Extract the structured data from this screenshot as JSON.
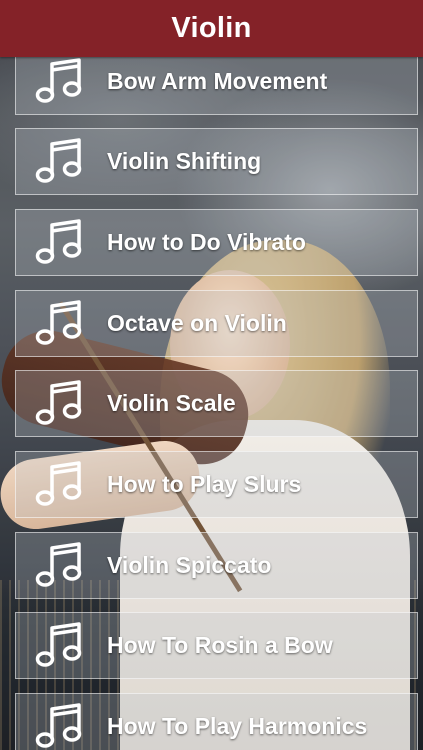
{
  "header": {
    "title": "Violin",
    "color": "#842228"
  },
  "list": {
    "items": [
      {
        "label": "Bow Arm Movement",
        "icon": "music-note-icon"
      },
      {
        "label": "Violin Shifting",
        "icon": "music-note-icon"
      },
      {
        "label": "How to Do Vibrato",
        "icon": "music-note-icon"
      },
      {
        "label": "Octave on Violin",
        "icon": "music-note-icon"
      },
      {
        "label": "Violin Scale",
        "icon": "music-note-icon"
      },
      {
        "label": "How to Play Slurs",
        "icon": "music-note-icon"
      },
      {
        "label": "Violin Spiccato",
        "icon": "music-note-icon"
      },
      {
        "label": "How To Rosin a Bow",
        "icon": "music-note-icon"
      },
      {
        "label": "How To Play Harmonics",
        "icon": "music-note-icon"
      }
    ]
  },
  "background": {
    "subject": "woman-playing-violin-photo"
  }
}
